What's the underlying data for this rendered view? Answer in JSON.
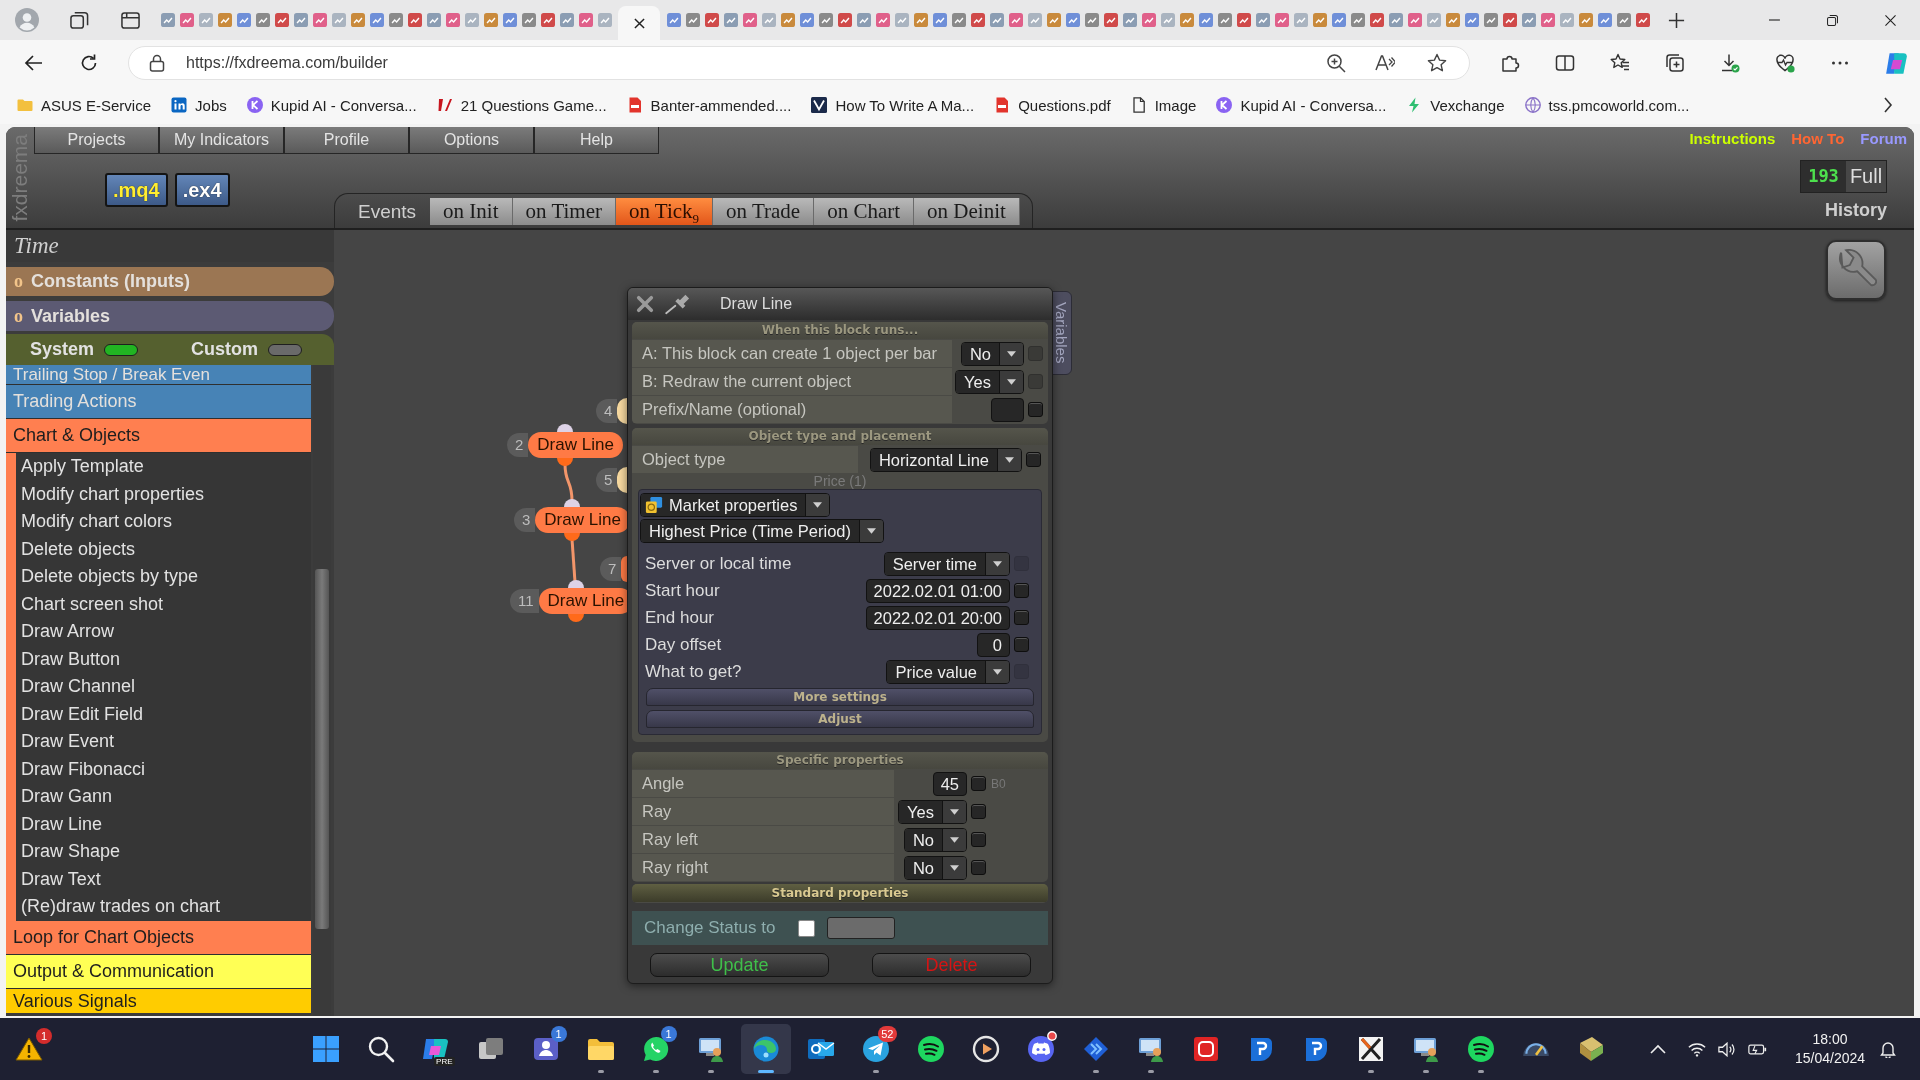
{
  "browser": {
    "tabs": [
      {
        "selected": false
      },
      {
        "selected": false
      },
      {
        "selected": false
      },
      {
        "selected": false
      },
      {
        "selected": false
      },
      {
        "selected": false
      },
      {
        "selected": false
      },
      {
        "selected": false
      },
      {
        "selected": false
      },
      {
        "selected": false
      },
      {
        "selected": false
      },
      {
        "selected": false
      },
      {
        "selected": false
      },
      {
        "selected": false
      },
      {
        "selected": false
      },
      {
        "selected": false
      },
      {
        "selected": false
      },
      {
        "selected": false
      },
      {
        "selected": false
      },
      {
        "selected": false
      },
      {
        "selected": false
      },
      {
        "selected": false
      },
      {
        "selected": false
      },
      {
        "selected": false
      },
      {
        "selected": true
      },
      {
        "selected": false
      },
      {
        "selected": false
      },
      {
        "selected": false
      },
      {
        "selected": false
      },
      {
        "selected": false
      },
      {
        "selected": false
      },
      {
        "selected": false
      },
      {
        "selected": false
      },
      {
        "selected": false
      },
      {
        "selected": false
      },
      {
        "selected": false
      },
      {
        "selected": false
      },
      {
        "selected": false
      },
      {
        "selected": false
      },
      {
        "selected": false
      },
      {
        "selected": false
      },
      {
        "selected": false
      },
      {
        "selected": false
      },
      {
        "selected": false
      },
      {
        "selected": false
      },
      {
        "selected": false
      },
      {
        "selected": false
      },
      {
        "selected": false
      },
      {
        "selected": false
      },
      {
        "selected": false
      },
      {
        "selected": false
      },
      {
        "selected": false
      },
      {
        "selected": false
      },
      {
        "selected": false
      },
      {
        "selected": false
      },
      {
        "selected": false
      },
      {
        "selected": false
      },
      {
        "selected": false
      },
      {
        "selected": false
      },
      {
        "selected": false
      },
      {
        "selected": false
      },
      {
        "selected": false
      },
      {
        "selected": false
      },
      {
        "selected": false
      },
      {
        "selected": false
      },
      {
        "selected": false
      },
      {
        "selected": false
      },
      {
        "selected": false
      },
      {
        "selected": false
      },
      {
        "selected": false
      },
      {
        "selected": false
      },
      {
        "selected": false
      },
      {
        "selected": false
      },
      {
        "selected": false
      },
      {
        "selected": false
      },
      {
        "selected": false
      },
      {
        "selected": false
      }
    ],
    "url": "https://fxdreema.com/builder",
    "bookmarks": [
      {
        "label": "ASUS E-Service",
        "kind": "folder"
      },
      {
        "label": "Jobs",
        "kind": "tile"
      },
      {
        "label": "Kupid AI - Conversa...",
        "kind": "circle"
      },
      {
        "label": "21 Questions Game...",
        "kind": "slash"
      },
      {
        "label": "Banter-ammended....",
        "kind": "document"
      },
      {
        "label": "How To Write A Ma...",
        "kind": "chevron"
      },
      {
        "label": "Questions.pdf",
        "kind": "document"
      },
      {
        "label": "Image",
        "kind": "file"
      },
      {
        "label": "Kupid AI - Conversa...",
        "kind": "circle"
      },
      {
        "label": "Vexchange",
        "kind": "bolt"
      },
      {
        "label": "tss.pmcoworld.com...",
        "kind": "globe"
      }
    ]
  },
  "app": {
    "brand": "fxdreema",
    "menu": [
      "Projects",
      "My Indicators",
      "Profile",
      "Options",
      "Help"
    ],
    "exports": [
      {
        "label": ".mq4",
        "color": "#ffee33"
      },
      {
        "label": ".ex4",
        "color": "#ffffff"
      }
    ],
    "links": [
      {
        "label": "Instructions",
        "color": "#ccff00"
      },
      {
        "label": "How To",
        "color": "#ff6633"
      },
      {
        "label": "Forum",
        "color": "#9999ff"
      }
    ],
    "counter": "193",
    "counter_mode": "Full",
    "history": "History",
    "events_label": "Events",
    "events": [
      {
        "label": "on Init",
        "selected": false
      },
      {
        "label": "on Timer",
        "selected": false
      },
      {
        "label": "on Tick$_{9}$",
        "selected": true
      },
      {
        "label": "on Trade",
        "selected": false
      },
      {
        "label": "on Chart",
        "selected": false
      },
      {
        "label": "on Deinit",
        "selected": false
      }
    ]
  },
  "sidebar": {
    "title": "Time",
    "panels": [
      {
        "marker": "o",
        "label": "Constants (Inputs)",
        "color": "#9b7653"
      },
      {
        "marker": "o",
        "label": "Variables",
        "color": "#5c5a73"
      }
    ],
    "toggles": [
      {
        "label": "System",
        "on": true
      },
      {
        "label": "Custom",
        "on": false
      }
    ],
    "categories": [
      {
        "label": "Trailing Stop / Break Even",
        "color": "#4783b6"
      },
      {
        "label": "Trading Actions",
        "color": "#4783b6"
      },
      {
        "label": "Chart & Objects",
        "color": "#ff7f50",
        "children": [
          "Apply Template",
          "Modify chart properties",
          "Modify chart colors",
          "Delete objects",
          "Delete objects by type",
          "Chart screen shot",
          "Draw Arrow",
          "Draw Button",
          "Draw Channel",
          "Draw Edit Field",
          "Draw Event",
          "Draw Fibonacci",
          "Draw Gann",
          "Draw Line",
          "Draw Shape",
          "Draw Text",
          "(Re)draw trades on chart"
        ]
      },
      {
        "label": "Loop for Chart Objects",
        "color": "#ff7f50"
      },
      {
        "label": "Output & Communication",
        "color": "#ffff55"
      },
      {
        "label": "Various Signals",
        "color": "#ffcc00"
      }
    ]
  },
  "canvas": {
    "blocks": [
      {
        "number": "4",
        "color": "#f7d9a0"
      },
      {
        "number": "2",
        "label": "Draw Line",
        "color": "#ff7a45"
      },
      {
        "number": "5",
        "color": "#f7d9a0"
      },
      {
        "number": "3",
        "label": "Draw Line",
        "color": "#ff7a45"
      },
      {
        "number": "7",
        "color": "#ff7a45"
      },
      {
        "number": "11",
        "label": "Draw Line",
        "color": "#ff7a45"
      }
    ]
  },
  "dialog": {
    "title": "Draw Line",
    "side_tab": "Variables",
    "sections": [
      {
        "title": "When this block runs...",
        "expanded": true,
        "rows": [
          {
            "label": "A: This block can create 1 object per bar",
            "kind": "select",
            "value": "No",
            "checked": false,
            "disabled": true
          },
          {
            "label": "B: Redraw the current object",
            "kind": "select",
            "value": "Yes",
            "checked": false,
            "disabled": true
          },
          {
            "label": "Prefix/Name (optional)",
            "kind": "input",
            "checked": false,
            "disabled": false
          }
        ]
      },
      {
        "title": "Object type and placement",
        "expanded": true,
        "rows": [
          {
            "label": "Object type",
            "kind": "select",
            "value": "Horizontal Line",
            "checked": false,
            "disabled": false
          }
        ],
        "group": {
          "title": "Price (1)",
          "source": "Market properties",
          "function": "Highest Price (Time Period)",
          "rows": [
            {
              "label": "Server or local time",
              "kind": "select",
              "value": "Server time",
              "checked": false,
              "disabled": true
            },
            {
              "label": "Start hour",
              "kind": "input",
              "value": "2022.02.01 01:00",
              "checked": false,
              "disabled": false
            },
            {
              "label": "End hour",
              "kind": "input",
              "value": "2022.02.01 20:00",
              "checked": false,
              "disabled": false
            },
            {
              "label": "Day offset",
              "kind": "input",
              "value": "0",
              "checked": false,
              "disabled": false
            },
            {
              "label": "What to get?",
              "kind": "select",
              "value": "Price value",
              "checked": false,
              "disabled": true
            }
          ],
          "buttons": [
            "More settings",
            "Adjust"
          ]
        }
      },
      {
        "title": "Specific properties",
        "expanded": true,
        "rows": [
          {
            "label": "Angle",
            "kind": "input",
            "value": "45",
            "checked": false,
            "disabled": false,
            "note": "B0"
          },
          {
            "label": "Ray",
            "kind": "select",
            "value": "Yes",
            "checked": false,
            "disabled": false
          },
          {
            "label": "Ray left",
            "kind": "select",
            "value": "No",
            "checked": false,
            "disabled": false
          },
          {
            "label": "Ray right",
            "kind": "select",
            "value": "No",
            "checked": false,
            "disabled": false
          }
        ]
      },
      {
        "title": "Standard properties",
        "expanded": false
      }
    ],
    "status": {
      "label": "Change Status to",
      "checked": false
    },
    "buttons": [
      {
        "label": "Update",
        "kind": "update"
      },
      {
        "label": "Delete",
        "kind": "delete"
      }
    ]
  },
  "taskbar": {
    "alert_badge": "1",
    "apps": [
      {
        "kind": "grid",
        "running": false,
        "selected": false,
        "alert": false
      },
      {
        "kind": "search",
        "running": false,
        "selected": false,
        "alert": false
      },
      {
        "kind": "swirl",
        "tag": "PRE",
        "running": false,
        "selected": false,
        "alert": false
      },
      {
        "kind": "windows",
        "running": false,
        "selected": false,
        "alert": false
      },
      {
        "kind": "people",
        "badge": "1",
        "running": false,
        "selected": false,
        "alert": false
      },
      {
        "kind": "folder",
        "running": true,
        "selected": false,
        "alert": false
      },
      {
        "kind": "chat",
        "badge": "1",
        "running": true,
        "selected": false,
        "alert": false
      },
      {
        "kind": "userpc",
        "running": true,
        "selected": false,
        "alert": false
      },
      {
        "kind": "browser",
        "running": true,
        "selected": true,
        "alert": false
      },
      {
        "kind": "mail",
        "running": false,
        "selected": false,
        "alert": false
      },
      {
        "kind": "plane",
        "badge": "52",
        "running": true,
        "selected": false,
        "alert": false
      },
      {
        "kind": "waves",
        "running": false,
        "selected": false,
        "alert": false
      },
      {
        "kind": "play",
        "running": false,
        "selected": false,
        "alert": false
      },
      {
        "kind": "controller",
        "running": false,
        "selected": false,
        "alert": true
      },
      {
        "kind": "arrows",
        "running": true,
        "selected": false,
        "alert": false
      },
      {
        "kind": "userpc",
        "running": true,
        "selected": false,
        "alert": false
      },
      {
        "kind": "tile",
        "running": false,
        "selected": false,
        "alert": false
      },
      {
        "kind": "shield",
        "running": false,
        "selected": false,
        "alert": false
      },
      {
        "kind": "shield",
        "running": false,
        "selected": false,
        "alert": false
      },
      {
        "kind": "cross",
        "running": true,
        "selected": false,
        "alert": false
      },
      {
        "kind": "userpc",
        "running": true,
        "selected": false,
        "alert": false
      },
      {
        "kind": "waves",
        "running": true,
        "selected": false,
        "alert": false
      },
      {
        "kind": "gauge",
        "running": false,
        "selected": false,
        "alert": false
      },
      {
        "kind": "notebook",
        "running": false,
        "selected": false,
        "alert": false
      }
    ],
    "clock": {
      "time": "18:00",
      "date": "15/04/2024"
    }
  }
}
